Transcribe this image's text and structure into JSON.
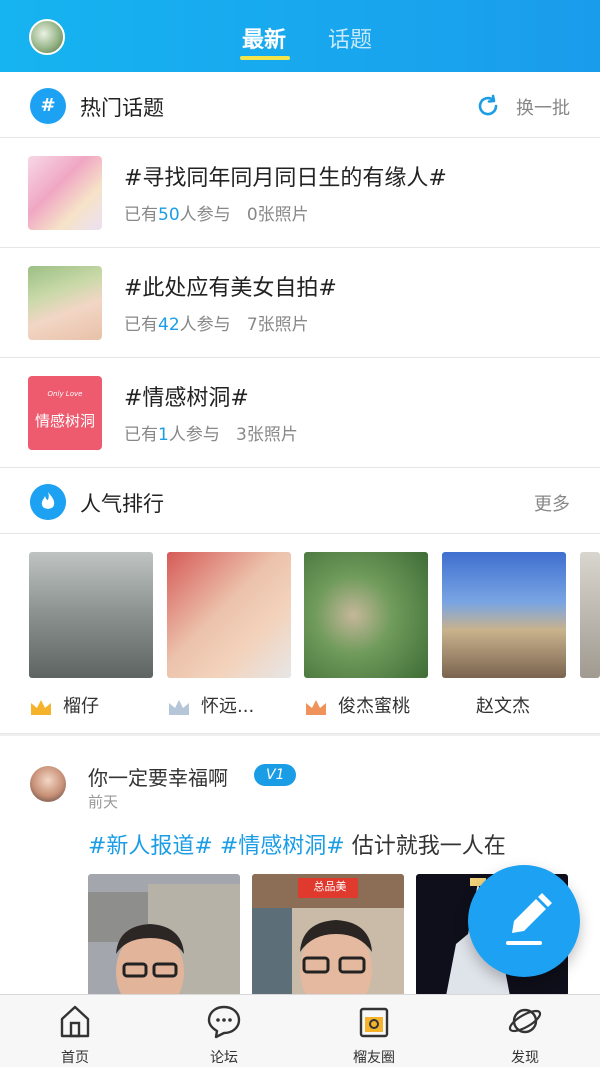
{
  "header": {
    "tabs": [
      {
        "label": "最新",
        "active": true
      },
      {
        "label": "话题",
        "active": false
      }
    ]
  },
  "hot_topics": {
    "title": "热门话题",
    "icon": "hashtag-icon",
    "action": "换一批",
    "items": [
      {
        "title": "#寻找同年同月同日生的有缘人#",
        "prefix": "已有",
        "count": "50",
        "suffix": "人参与",
        "photos": "0张照片"
      },
      {
        "title": "#此处应有美女自拍#",
        "prefix": "已有",
        "count": "42",
        "suffix": "人参与",
        "photos": "7张照片"
      },
      {
        "title": "#情感树洞#",
        "prefix": "已有",
        "count": "1",
        "suffix": "人参与",
        "photos": "3张照片",
        "thumb_logo_text": "Only Love",
        "thumb_text": "情感树洞"
      }
    ]
  },
  "ranking": {
    "title": "人气排行",
    "icon": "flame-icon",
    "action": "更多",
    "items": [
      {
        "name": "榴仔",
        "crown": "gold"
      },
      {
        "name": "怀远...",
        "crown": "silver"
      },
      {
        "name": "俊杰蜜桃",
        "crown": "bronze"
      },
      {
        "name": "赵文杰",
        "crown": ""
      }
    ]
  },
  "post": {
    "user": "你一定要幸福啊",
    "badge": "V1",
    "time": "前天",
    "tags": [
      "#新人报道#",
      "#情感树洞#"
    ],
    "text": "估计就我一人在",
    "photo3_sign": "总品美"
  },
  "tabbar": [
    {
      "label": "首页",
      "icon": "home-icon"
    },
    {
      "label": "论坛",
      "icon": "chat-bubble-icon"
    },
    {
      "label": "榴友圈",
      "icon": "camera-icon"
    },
    {
      "label": "发现",
      "icon": "planet-icon"
    }
  ],
  "colors": {
    "header": "#1a9cec",
    "accent": "#1b9de6",
    "underline": "#f4e64a"
  }
}
